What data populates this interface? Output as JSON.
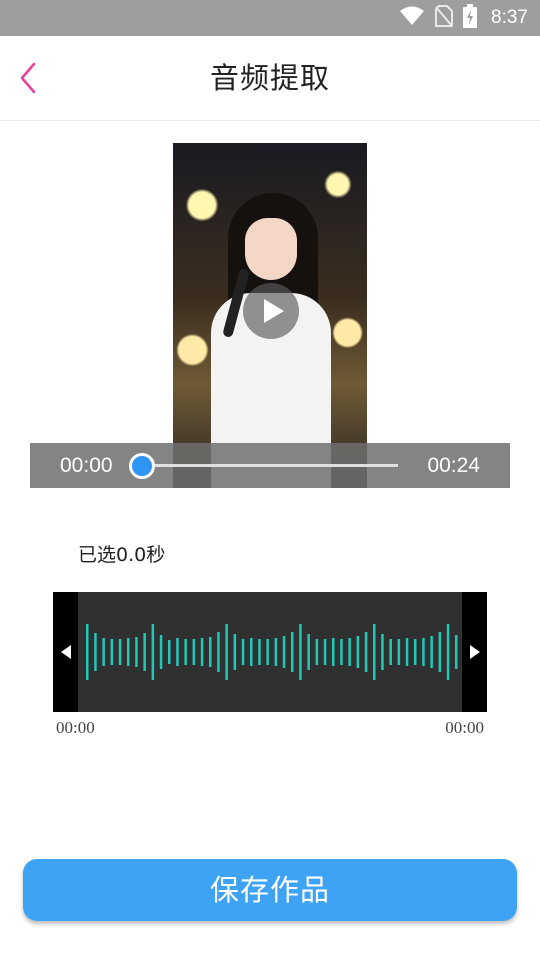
{
  "status_bar": {
    "time": "8:37",
    "icons": [
      "wifi-icon",
      "no-sim-icon",
      "battery-charging-icon"
    ]
  },
  "header": {
    "title": "音频提取",
    "back_icon": "chevron-left-icon",
    "accent": "#e83e9e"
  },
  "player": {
    "current_time": "00:00",
    "total_time": "00:24",
    "progress": 0,
    "thumb_color": "#2f95f4"
  },
  "selection": {
    "label": "已选0.0秒"
  },
  "waveform": {
    "start_time": "00:00",
    "end_time": "00:00",
    "bar_color": "#1ec9b8"
  },
  "save": {
    "label": "保存作品",
    "color": "#3fa3f5"
  }
}
